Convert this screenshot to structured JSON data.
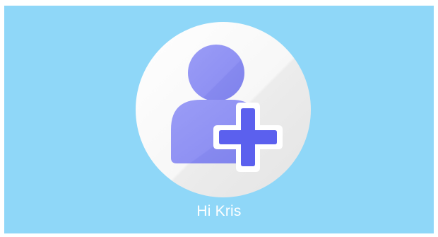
{
  "profile": {
    "greeting": "Hi Kris",
    "avatar_icon": "add-user-icon"
  },
  "colors": {
    "background": "#8fd7f8",
    "circle": "#f2f2f2",
    "person": "#8f91f3",
    "plus": "#5b60ee",
    "greeting_text": "#ffffff"
  }
}
